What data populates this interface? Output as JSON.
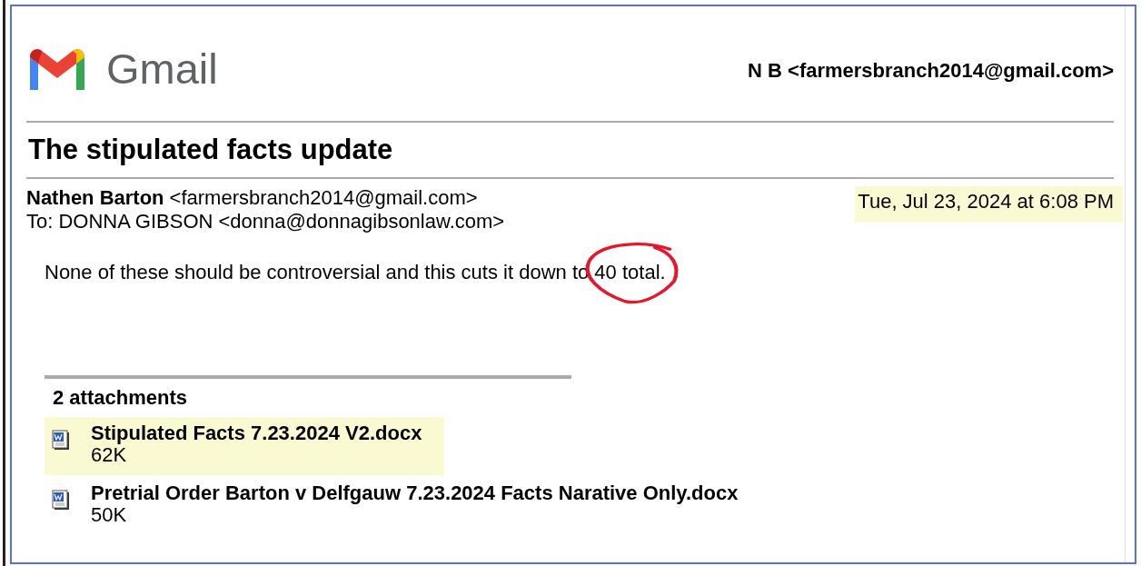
{
  "logo": {
    "text": "Gmail"
  },
  "account": "N B <farmersbranch2014@gmail.com>",
  "subject": "The stipulated facts update",
  "message": {
    "sender_name": "Nathen Barton",
    "sender_email": "<farmersbranch2014@gmail.com>",
    "to": "To: DONNA GIBSON <donna@donnagibsonlaw.com>",
    "date": "Tue, Jul 23, 2024 at 6:08 PM",
    "date_highlighted": true,
    "body": "None of these should be controversial and this cuts it down to 40 total.",
    "circle_annotation": true
  },
  "attachments": {
    "heading": "2 attachments",
    "items": [
      {
        "name": "Stipulated Facts 7.23.2024 V2.docx",
        "size": "62K",
        "highlighted": true
      },
      {
        "name": "Pretrial Order Barton v Delfgauw 7.23.2024 Facts Narative Only.docx",
        "size": "50K",
        "highlighted": false
      }
    ]
  }
}
